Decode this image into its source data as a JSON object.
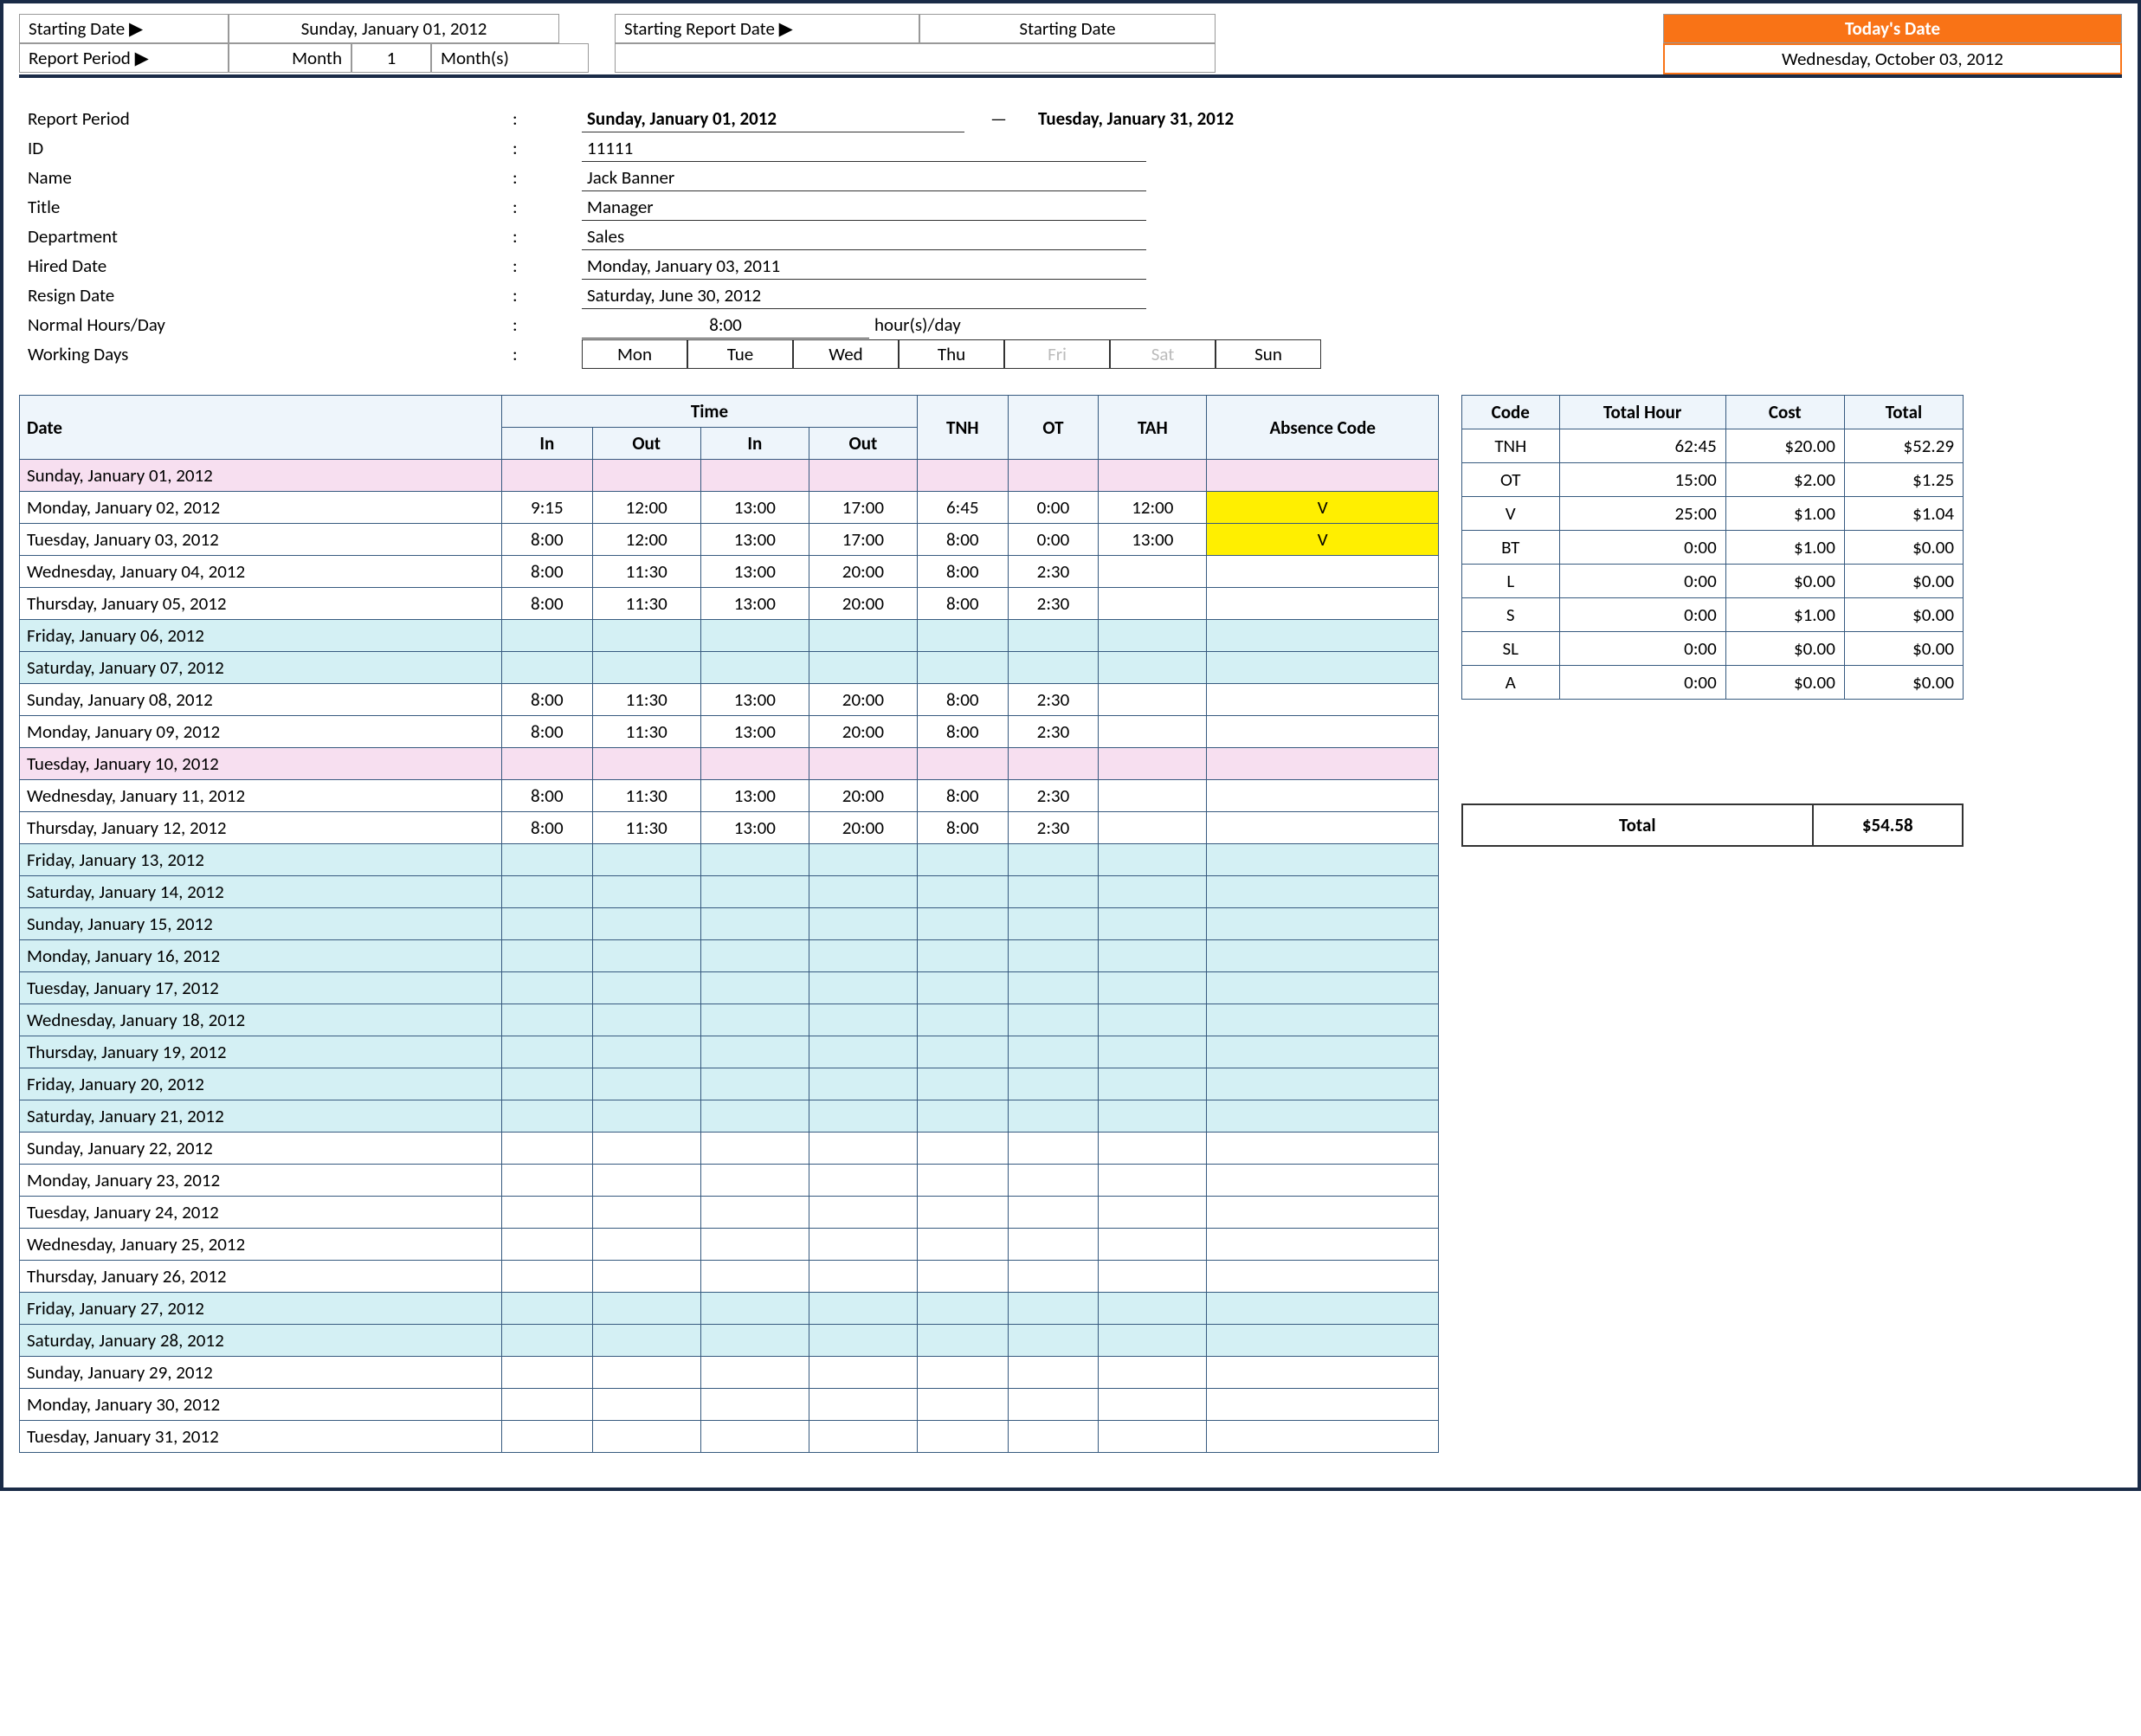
{
  "top": {
    "starting_date_lbl": "Starting Date ▶",
    "starting_date_val": "Sunday, January 01, 2012",
    "report_period_lbl": "Report Period ▶",
    "report_period_month_lbl": "Month",
    "report_period_val": "1",
    "report_period_months_lbl": "Month(s)",
    "starting_report_lbl": "Starting Report Date ▶",
    "starting_report_val": "Starting Date",
    "today_hdr": "Today's Date",
    "today_val": "Wednesday, October 03, 2012"
  },
  "info": {
    "report_period_lbl": "Report Period",
    "report_from": "Sunday, January 01, 2012",
    "report_dash": "—",
    "report_to": "Tuesday, January 31, 2012",
    "id_lbl": "ID",
    "id_val": "11111",
    "name_lbl": "Name",
    "name_val": "Jack Banner",
    "title_lbl": "Title",
    "title_val": "Manager",
    "dept_lbl": "Department",
    "dept_val": "Sales",
    "hired_lbl": "Hired Date",
    "hired_val": "Monday, January 03, 2011",
    "resign_lbl": "Resign Date",
    "resign_val": "Saturday, June 30, 2012",
    "normal_lbl": "Normal Hours/Day",
    "normal_val": "8:00",
    "normal_unit": "hour(s)/day",
    "workdays_lbl": "Working Days",
    "days": [
      {
        "d": "Mon",
        "on": true
      },
      {
        "d": "Tue",
        "on": true
      },
      {
        "d": "Wed",
        "on": true
      },
      {
        "d": "Thu",
        "on": true
      },
      {
        "d": "Fri",
        "on": false
      },
      {
        "d": "Sat",
        "on": false
      },
      {
        "d": "Sun",
        "on": true
      }
    ]
  },
  "ts": {
    "hdr": {
      "date": "Date",
      "time": "Time",
      "in": "In",
      "out": "Out",
      "tnh": "TNH",
      "ot": "OT",
      "tah": "TAH",
      "abs": "Absence Code"
    },
    "rows": [
      {
        "date": "Sunday, January 01, 2012",
        "class": "pink"
      },
      {
        "date": "Monday, January 02, 2012",
        "in1": "9:15",
        "out1": "12:00",
        "in2": "13:00",
        "out2": "17:00",
        "tnh": "6:45",
        "ot": "0:00",
        "tah": "12:00",
        "abs": "V"
      },
      {
        "date": "Tuesday, January 03, 2012",
        "in1": "8:00",
        "out1": "12:00",
        "in2": "13:00",
        "out2": "17:00",
        "tnh": "8:00",
        "ot": "0:00",
        "tah": "13:00",
        "abs": "V"
      },
      {
        "date": "Wednesday, January 04, 2012",
        "in1": "8:00",
        "out1": "11:30",
        "in2": "13:00",
        "out2": "20:00",
        "tnh": "8:00",
        "ot": "2:30"
      },
      {
        "date": "Thursday, January 05, 2012",
        "in1": "8:00",
        "out1": "11:30",
        "in2": "13:00",
        "out2": "20:00",
        "tnh": "8:00",
        "ot": "2:30"
      },
      {
        "date": "Friday, January 06, 2012",
        "class": "cyan"
      },
      {
        "date": "Saturday, January 07, 2012",
        "class": "cyan"
      },
      {
        "date": "Sunday, January 08, 2012",
        "in1": "8:00",
        "out1": "11:30",
        "in2": "13:00",
        "out2": "20:00",
        "tnh": "8:00",
        "ot": "2:30"
      },
      {
        "date": "Monday, January 09, 2012",
        "in1": "8:00",
        "out1": "11:30",
        "in2": "13:00",
        "out2": "20:00",
        "tnh": "8:00",
        "ot": "2:30"
      },
      {
        "date": "Tuesday, January 10, 2012",
        "class": "pink"
      },
      {
        "date": "Wednesday, January 11, 2012",
        "in1": "8:00",
        "out1": "11:30",
        "in2": "13:00",
        "out2": "20:00",
        "tnh": "8:00",
        "ot": "2:30"
      },
      {
        "date": "Thursday, January 12, 2012",
        "in1": "8:00",
        "out1": "11:30",
        "in2": "13:00",
        "out2": "20:00",
        "tnh": "8:00",
        "ot": "2:30"
      },
      {
        "date": "Friday, January 13, 2012",
        "class": "cyan"
      },
      {
        "date": "Saturday, January 14, 2012",
        "class": "cyan"
      },
      {
        "date": "Sunday, January 15, 2012",
        "class": "cyan"
      },
      {
        "date": "Monday, January 16, 2012",
        "class": "cyan"
      },
      {
        "date": "Tuesday, January 17, 2012",
        "class": "cyan"
      },
      {
        "date": "Wednesday, January 18, 2012",
        "class": "cyan"
      },
      {
        "date": "Thursday, January 19, 2012",
        "class": "cyan"
      },
      {
        "date": "Friday, January 20, 2012",
        "class": "cyan"
      },
      {
        "date": "Saturday, January 21, 2012",
        "class": "cyan"
      },
      {
        "date": "Sunday, January 22, 2012"
      },
      {
        "date": "Monday, January 23, 2012"
      },
      {
        "date": "Tuesday, January 24, 2012"
      },
      {
        "date": "Wednesday, January 25, 2012"
      },
      {
        "date": "Thursday, January 26, 2012"
      },
      {
        "date": "Friday, January 27, 2012",
        "class": "cyan"
      },
      {
        "date": "Saturday, January 28, 2012",
        "class": "cyan"
      },
      {
        "date": "Sunday, January 29, 2012"
      },
      {
        "date": "Monday, January 30, 2012"
      },
      {
        "date": "Tuesday, January 31, 2012"
      }
    ]
  },
  "summary": {
    "hdr": {
      "code": "Code",
      "hours": "Total Hour",
      "cost": "Cost",
      "total": "Total"
    },
    "rows": [
      {
        "code": "TNH",
        "hours": "62:45",
        "cost": "$20.00",
        "total": "$52.29"
      },
      {
        "code": "OT",
        "hours": "15:00",
        "cost": "$2.00",
        "total": "$1.25"
      },
      {
        "code": "V",
        "hours": "25:00",
        "cost": "$1.00",
        "total": "$1.04"
      },
      {
        "code": "BT",
        "hours": "0:00",
        "cost": "$1.00",
        "total": "$0.00"
      },
      {
        "code": "L",
        "hours": "0:00",
        "cost": "$0.00",
        "total": "$0.00"
      },
      {
        "code": "S",
        "hours": "0:00",
        "cost": "$1.00",
        "total": "$0.00"
      },
      {
        "code": "SL",
        "hours": "0:00",
        "cost": "$0.00",
        "total": "$0.00"
      },
      {
        "code": "A",
        "hours": "0:00",
        "cost": "$0.00",
        "total": "$0.00"
      }
    ],
    "grand_lbl": "Total",
    "grand_val": "$54.58"
  }
}
